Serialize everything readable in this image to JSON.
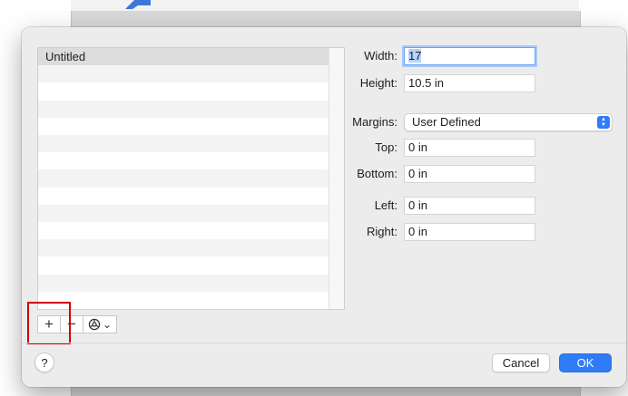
{
  "paper_list": {
    "rows": [
      "Untitled"
    ]
  },
  "list_controls": {
    "add_label": "+",
    "remove_label": "−",
    "action_chevron": "⌄"
  },
  "form": {
    "width_label": "Width:",
    "width_value": "17",
    "height_label": "Height:",
    "height_value": "10.5 in",
    "margins_label": "Margins:",
    "margins_value": "User Defined",
    "top_label": "Top:",
    "top_value": "0 in",
    "bottom_label": "Bottom:",
    "bottom_value": "0 in",
    "left_label": "Left:",
    "left_value": "0 in",
    "right_label": "Right:",
    "right_value": "0 in"
  },
  "footer": {
    "help_label": "?",
    "cancel_label": "Cancel",
    "ok_label": "OK"
  },
  "colors": {
    "accent": "#2f7cf6",
    "highlight": "#d10000"
  }
}
